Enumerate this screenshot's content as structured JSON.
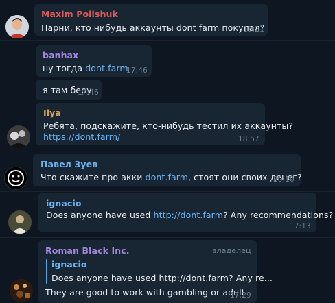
{
  "messages": [
    {
      "sender": "Maxim Polishuk",
      "text": "Парни, кто нибудь аккаунты dont farm покупал?",
      "time": "15:21",
      "name_color": "#e05a5a"
    },
    {
      "sender": "banhax",
      "text_prefix": "ну тогда ",
      "link": "dont.farm",
      "time": "17:46",
      "name_color": "#a586e0"
    },
    {
      "text": "я там беру",
      "time": "17:46"
    },
    {
      "sender": "Ilya",
      "text": "Ребята, подскажите, кто-нибудь тестил их аккаунты?",
      "link": "https://dont.farm/",
      "time": "18:57",
      "name_color": "#e0a05a"
    },
    {
      "sender": "Павел Зуев",
      "text_prefix": "Что скажите про акки ",
      "link": "dont.farm",
      "text_suffix": ", стоят они своих денег?",
      "time": "20:10",
      "name_color": "#6ab3f3"
    },
    {
      "sender": "ignacio",
      "text_prefix": "Does anyone have used ",
      "link": "http://dont.farm",
      "text_suffix": "? Any recommendations?",
      "time": "17:13",
      "name_color": "#6ab3f3"
    },
    {
      "sender": "Roman Black Inc.",
      "role": "владелец",
      "reply_sender": "ignacio",
      "reply_text": "Does anyone have used http://dont.farm? Any re...",
      "text": "They are good to work with gambling or adult",
      "time": "17:29",
      "name_color": "#a586e0"
    }
  ]
}
